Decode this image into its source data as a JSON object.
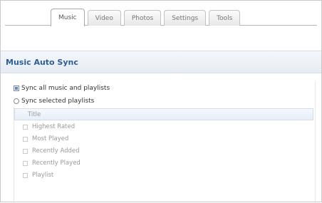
{
  "tabs": [
    {
      "label": "Music",
      "active": true
    },
    {
      "label": "Video",
      "active": false
    },
    {
      "label": "Photos",
      "active": false
    },
    {
      "label": "Settings",
      "active": false
    },
    {
      "label": "Tools",
      "active": false
    }
  ],
  "section": {
    "title": "Music Auto Sync"
  },
  "options": {
    "sync_all_label": "Sync all music and playlists",
    "sync_all_checked": true,
    "sync_selected_label": "Sync selected playlists",
    "sync_selected_checked": false
  },
  "playlists": {
    "column_header": "Title",
    "items": [
      "Highest Rated",
      "Most Played",
      "Recently Added",
      "Recently Played",
      "Playlist"
    ]
  },
  "colors": {
    "accent": "#2e5e96",
    "checkbox_fill": "#5a8ad2"
  }
}
